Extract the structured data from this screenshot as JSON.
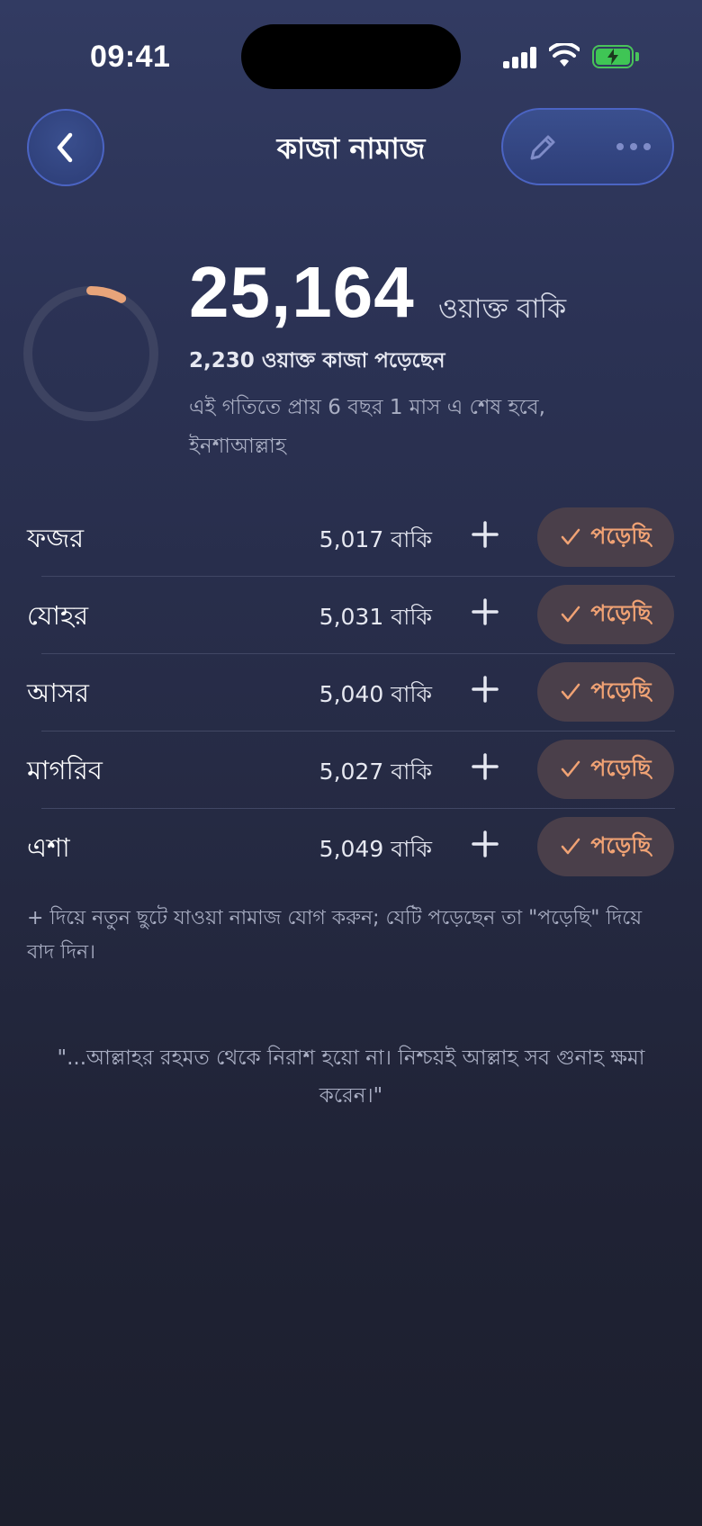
{
  "status_bar": {
    "time": "09:41",
    "icons": [
      "cellular-signal-icon",
      "wifi-icon",
      "battery-charging-icon"
    ]
  },
  "header": {
    "title": "কাজা নামাজ",
    "back_icon": "chevron-left-icon",
    "edit_icon": "pencil-icon",
    "more_icon": "more-dots-icon"
  },
  "summary": {
    "remaining_count": "25,164",
    "remaining_unit": "ওয়াক্ত বাকি",
    "completed_text": "2,230 ওয়াক্ত কাজা পড়েছেন",
    "estimate_text": "এই গতিতে প্রায় 6 বছর 1 মাস এ শেষ হবে, ইনশাআল্লাহ",
    "progress_fraction": 0.081
  },
  "prayers": [
    {
      "name": "ফজর",
      "remaining": "5,017 বাকি",
      "done_label": "পড়েছি"
    },
    {
      "name": "যোহর",
      "remaining": "5,031 বাকি",
      "done_label": "পড়েছি"
    },
    {
      "name": "আসর",
      "remaining": "5,040 বাকি",
      "done_label": "পড়েছি"
    },
    {
      "name": "মাগরিব",
      "remaining": "5,027 বাকি",
      "done_label": "পড়েছি"
    },
    {
      "name": "এশা",
      "remaining": "5,049 বাকি",
      "done_label": "পড়েছি"
    }
  ],
  "hint": "+ দিয়ে নতুন ছুটে যাওয়া নামাজ যোগ করুন; যেটি পড়েছেন তা \"পড়েছি\" দিয়ে বাদ দিন।",
  "quote": "\"...আল্লাহর রহমত থেকে নিরাশ হয়ো না। নিশ্চয়ই আল্লাহ সব গুনাহ ক্ষমা করেন।\"",
  "colors": {
    "accent": "#f0a274",
    "button_blue": "#3a4f8e",
    "done_button_bg": "#4a3f4a",
    "battery_green": "#3fc555"
  }
}
